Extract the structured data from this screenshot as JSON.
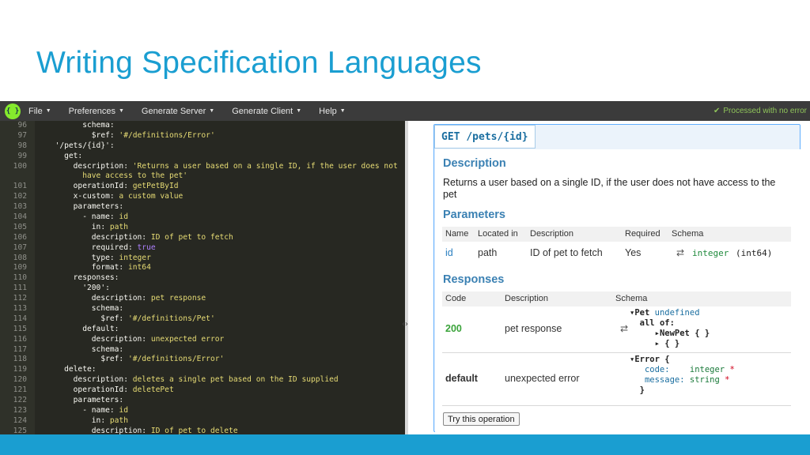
{
  "slide": {
    "title": "Writing Specification Languages"
  },
  "app": {
    "logo": "{ }",
    "menu": [
      {
        "label": "File"
      },
      {
        "label": "Preferences"
      },
      {
        "label": "Generate Server"
      },
      {
        "label": "Generate Client"
      },
      {
        "label": "Help"
      }
    ],
    "status": "Processed with no error"
  },
  "editor": {
    "lines": [
      {
        "n": "96",
        "fold": true,
        "text": "        schema:"
      },
      {
        "n": "97",
        "fold": false,
        "text": "          $ref: '#/definitions/Error'"
      },
      {
        "n": "98",
        "fold": true,
        "text": "  '/pets/{id}':"
      },
      {
        "n": "99",
        "fold": true,
        "text": "    get:"
      },
      {
        "n": "100",
        "fold": false,
        "text": "      description: 'Returns a user based on a single ID, if the user does not"
      },
      {
        "n": "",
        "fold": false,
        "text": "        have access to the pet'"
      },
      {
        "n": "101",
        "fold": false,
        "text": "      operationId: getPetById"
      },
      {
        "n": "102",
        "fold": false,
        "text": "      x-custom: a custom value"
      },
      {
        "n": "103",
        "fold": true,
        "text": "      parameters:"
      },
      {
        "n": "104",
        "fold": true,
        "text": "        - name: id"
      },
      {
        "n": "105",
        "fold": false,
        "text": "          in: path"
      },
      {
        "n": "106",
        "fold": false,
        "text": "          description: ID of pet to fetch"
      },
      {
        "n": "107",
        "fold": false,
        "text": "          required: true"
      },
      {
        "n": "108",
        "fold": false,
        "text": "          type: integer"
      },
      {
        "n": "109",
        "fold": false,
        "text": "          format: int64"
      },
      {
        "n": "110",
        "fold": true,
        "text": "      responses:"
      },
      {
        "n": "111",
        "fold": true,
        "text": "        '200':"
      },
      {
        "n": "112",
        "fold": false,
        "text": "          description: pet response"
      },
      {
        "n": "113",
        "fold": true,
        "text": "          schema:"
      },
      {
        "n": "114",
        "fold": false,
        "text": "            $ref: '#/definitions/Pet'"
      },
      {
        "n": "115",
        "fold": true,
        "text": "        default:"
      },
      {
        "n": "116",
        "fold": false,
        "text": "          description: unexpected error"
      },
      {
        "n": "117",
        "fold": true,
        "text": "          schema:"
      },
      {
        "n": "118",
        "fold": false,
        "text": "            $ref: '#/definitions/Error'"
      },
      {
        "n": "119",
        "fold": true,
        "text": "    delete:"
      },
      {
        "n": "120",
        "fold": false,
        "text": "      description: deletes a single pet based on the ID supplied"
      },
      {
        "n": "121",
        "fold": false,
        "text": "      operationId: deletePet"
      },
      {
        "n": "122",
        "fold": true,
        "text": "      parameters:"
      },
      {
        "n": "123",
        "fold": true,
        "text": "        - name: id"
      },
      {
        "n": "124",
        "fold": false,
        "text": "          in: path"
      },
      {
        "n": "125",
        "fold": false,
        "text": "          description: ID of pet to delete"
      }
    ]
  },
  "operation": {
    "method": "GET",
    "path": "/pets/{id}",
    "description_title": "Description",
    "description": "Returns a user based on a single ID, if the user does not have access to the pet",
    "parameters_title": "Parameters",
    "param_headers": {
      "name": "Name",
      "located_in": "Located in",
      "description": "Description",
      "required": "Required",
      "schema": "Schema"
    },
    "params": [
      {
        "name": "id",
        "located_in": "path",
        "description": "ID of pet to fetch",
        "required": "Yes",
        "schema_type": "integer",
        "schema_format": "(int64)"
      }
    ],
    "responses_title": "Responses",
    "resp_headers": {
      "code": "Code",
      "description": "Description",
      "schema": "Schema"
    },
    "responses": [
      {
        "code": "200",
        "description": "pet response",
        "model": {
          "name": "Pet",
          "suffix": "undefined",
          "allof": "all of:",
          "item1": "NewPet { }",
          "item2": "{ }"
        }
      },
      {
        "code": "default",
        "description": "unexpected error",
        "model": {
          "name": "Error",
          "open": "{",
          "f1_key": "code:",
          "f1_type": "integer",
          "f2_key": "message:",
          "f2_type": "string",
          "req": "*",
          "close": "}"
        }
      }
    ],
    "try_button": "Try this operation"
  },
  "colors": {
    "accent": "#1a9ed1",
    "editor_bg": "#272822",
    "menubar_bg": "#3b3b3b",
    "op_border": "#61affe",
    "success": "#3aa33a"
  }
}
